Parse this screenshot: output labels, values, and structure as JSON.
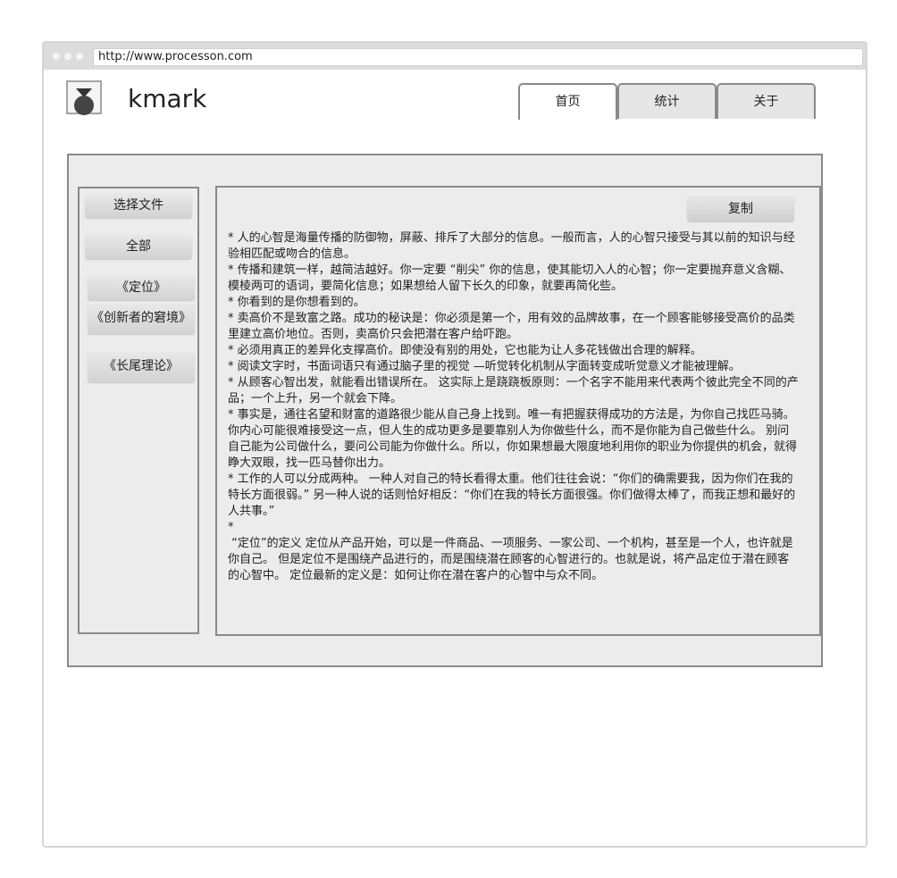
{
  "browser": {
    "url": "http://www.processon.com"
  },
  "header": {
    "logo_icon": "medal-icon",
    "brand": "kmark",
    "tabs": [
      {
        "label": "首页",
        "active": true
      },
      {
        "label": "统计",
        "active": false
      },
      {
        "label": "关于",
        "active": false
      }
    ]
  },
  "sidebar": {
    "items": [
      {
        "label": "选择文件"
      },
      {
        "label": "全部"
      },
      {
        "label": "《定位》"
      },
      {
        "label": "《创新者的窘境》"
      },
      {
        "label": "《长尾理论》"
      }
    ]
  },
  "content": {
    "copy_label": "复制",
    "body": "* 人的心智是海量传播的防御物，屏蔽、排斥了大部分的信息。一般而言，人的心智只接受与其以前的知识与经验相匹配或吻合的信息。\n* 传播和建筑一样，越简洁越好。你一定要 “削尖” 你的信息，使其能切入人的心智；你一定要抛弃意义含糊、模棱两可的语词，要简化信息；如果想给人留下长久的印象，就要再简化些。\n* 你看到的是你想看到的。\n* 卖高价不是致富之路。成功的秘诀是：你必须是第一个，用有效的品牌故事，在一个顾客能够接受高价的品类里建立高价地位。否则，卖高价只会把潜在客户给吓跑。\n* 必须用真正的差异化支撑高价。即使没有别的用处，它也能为让人多花钱做出合理的解释。\n* 阅读文字时，书面词语只有通过脑子里的视觉 —听觉转化机制从字面转变成听觉意义才能被理解。\n* 从顾客心智出发，就能看出错误所在。 这实际上是跷跷板原则：一个名字不能用来代表两个彼此完全不同的产品；一个上升，另一个就会下降。\n* 事实是，通往名望和财富的道路很少能从自己身上找到。唯一有把握获得成功的方法是，为你自己找匹马骑。你内心可能很难接受这一点，但人生的成功更多是要靠别人为你做些什么，而不是你能为自己做些什么。 别问自己能为公司做什么，要问公司能为你做什么。所以，你如果想最大限度地利用你的职业为你提供的机会，就得睁大双眼，找一匹马替你出力。\n* 工作的人可以分成两种。 一种人对自己的特长看得太重。他们往往会说：“你们的确需要我，因为你们在我的特长方面很弱。” 另一种人说的话则恰好相反：“你们在我的特长方面很强。你们做得太棒了，而我正想和最好的人共事。”\n*\n “定位”的定义 定位从产品开始，可以是一件商品、一项服务、一家公司、一个机构，甚至是一个人，也许就是你自己。 但是定位不是围绕产品进行的，而是围绕潜在顾客的心智进行的。也就是说，将产品定位于潜在顾客的心智中。 定位最新的定义是：如何让你在潜在客户的心智中与众不同。"
  }
}
